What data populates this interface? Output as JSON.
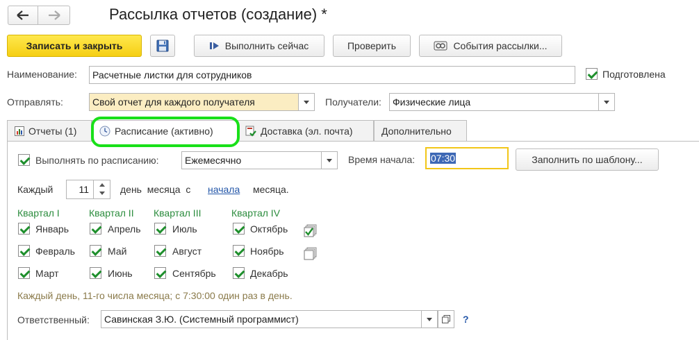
{
  "window": {
    "title": "Рассылка отчетов (создание) *"
  },
  "nav": {
    "back_icon": "arrow-left",
    "forward_icon": "arrow-right"
  },
  "toolbar": {
    "save_close": "Записать и закрыть",
    "save_icon": "floppy-disk",
    "run_now": "Выполнить сейчас",
    "check": "Проверить",
    "events": "События рассылки..."
  },
  "form": {
    "name_label": "Наименование:",
    "name_value": "Расчетные листки для сотрудников",
    "prepared_label": "Подготовлена",
    "prepared_checked": true,
    "send_label": "Отправлять:",
    "send_value": "Свой отчет для каждого получателя",
    "recipients_label": "Получатели:",
    "recipients_value": "Физические лица"
  },
  "tabs": [
    {
      "label": "Отчеты (1)",
      "icon": "report-chart",
      "active": false
    },
    {
      "label": "Расписание (активно)",
      "icon": "clock",
      "active": true
    },
    {
      "label": "Доставка (эл. почта)",
      "icon": "delivery-check",
      "active": false
    },
    {
      "label": "Дополнительно",
      "icon": "",
      "active": false
    }
  ],
  "schedule": {
    "run_by_schedule_label": "Выполнять по расписанию:",
    "run_by_schedule_checked": true,
    "period_value": "Ежемесячно",
    "start_time_label": "Время начала:",
    "start_time_value": "07:30",
    "fill_template_button": "Заполнить по шаблону...",
    "every_label": "Каждый",
    "day_number": "11",
    "day_of_month_label": "день  месяца  с",
    "from_link": "начала",
    "month_suffix": "месяца.",
    "quarters": [
      {
        "title": "Квартал I",
        "months": [
          "Январь",
          "Февраль",
          "Март"
        ]
      },
      {
        "title": "Квартал II",
        "months": [
          "Апрель",
          "Май",
          "Июнь"
        ]
      },
      {
        "title": "Квартал III",
        "months": [
          "Июль",
          "Август",
          "Сентябрь"
        ]
      },
      {
        "title": "Квартал IV",
        "months": [
          "Октябрь",
          "Ноябрь",
          "Декабрь"
        ]
      }
    ],
    "select_all_icon": "check-all",
    "clear_all_icon": "uncheck-all",
    "summary": "Каждый день, 11-го числа месяца; с 7:30:00 один раз в день.",
    "responsible_label": "Ответственный:",
    "responsible_value": "Савинская З.Ю. (Системный программист)",
    "help_mark": "?"
  },
  "colors": {
    "accent_yellow": "#f5cf14",
    "highlight_green": "#19e019",
    "check_green": "#1e8f2c",
    "quarter_green": "#2b8c3d",
    "link_blue": "#2356a8"
  }
}
